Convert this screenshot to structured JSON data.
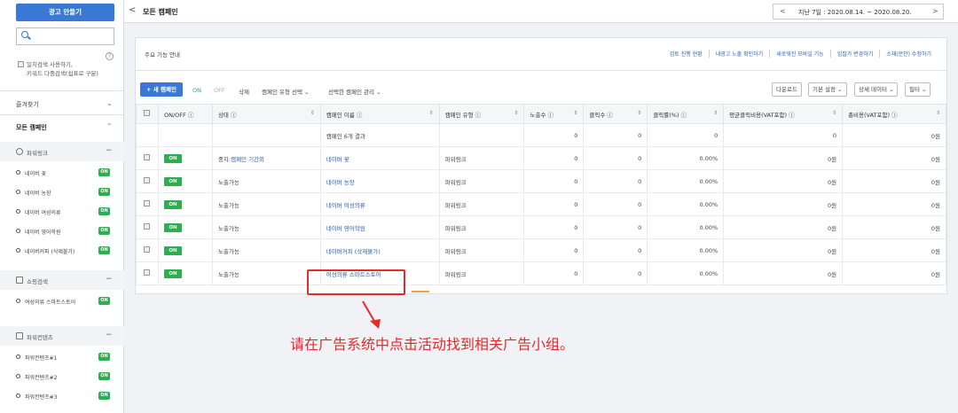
{
  "sidebar": {
    "create_ad_label": "광고 만들기",
    "search_placeholder": "",
    "option_line1": "일치검색 사용하기,",
    "option_line2": "키워드 다중검색(쉼표로 구분)",
    "help": "?",
    "favorites_label": "즐겨찾기",
    "all_campaigns_label": "모든 캠페인",
    "groups": [
      {
        "label": "파워링크",
        "items": [
          {
            "label": "네이버 꽃",
            "status": "ON"
          },
          {
            "label": "네이버 농장",
            "status": "ON"
          },
          {
            "label": "네이버 여성의류",
            "status": "ON"
          },
          {
            "label": "네이버 영어학원",
            "status": "ON"
          },
          {
            "label": "네이버커피 (삭제불가)",
            "status": "ON"
          }
        ]
      },
      {
        "label": "쇼핑검색",
        "items": [
          {
            "label": "여성의류 스마트스토어",
            "status": "ON"
          }
        ]
      },
      {
        "label": "파워컨텐츠",
        "items": [
          {
            "label": "파워컨텐츠#1",
            "status": "ON"
          },
          {
            "label": "파워컨텐츠#2",
            "status": "ON"
          },
          {
            "label": "파워컨텐츠#3",
            "status": "ON"
          }
        ]
      }
    ]
  },
  "header": {
    "back": "<",
    "title": "모든 캠페인",
    "date_prev": "<",
    "date_range": "지난 7일 : 2020.08.14. ~ 2020.08.20.",
    "date_next": ">"
  },
  "guide": {
    "label": "주요 기능 안내",
    "links": [
      "검토 진행 현황",
      "내광고 노출 확인하기",
      "새로워진 모바일 기능",
      "입찰가 변경하기",
      "소재(문안) 수정하기"
    ]
  },
  "toolbar": {
    "new_campaign": "+ 새 캠페인",
    "on": "ON",
    "off": "OFF",
    "delete": "삭제",
    "type_select": "캠페인 유형 선택 ⌄",
    "manage_select": "선택한 캠페인 관리 ⌄",
    "download": "다운로드",
    "default_setting": "기본 설정 ⌄",
    "detail_data": "상세 데이터 ⌄",
    "filter": "필터 ⌄"
  },
  "table": {
    "headers": [
      "ON/OFF ⓘ",
      "상태 ⓘ",
      "캠페인 이름 ⓘ",
      "캠페인 유형 ⓘ",
      "노출수 ⓘ",
      "클릭수 ⓘ",
      "클릭률(%) ⓘ",
      "평균클릭비용(VAT포함) ⓘ",
      "총비용(VAT포함) ⓘ"
    ],
    "total": {
      "name": "캠페인 6개 결과",
      "impressions": "0",
      "clicks": "0",
      "ctr": "0",
      "cpc": "0",
      "cost": "0원"
    },
    "rows": [
      {
        "switch": "ON",
        "status_prefix": "중지:",
        "status_link": "캠페인 기간외",
        "name": "네이버 꽃",
        "type": "파워링크",
        "impressions": "0",
        "clicks": "0",
        "ctr": "0.00%",
        "cpc": "0원",
        "cost": "0원"
      },
      {
        "switch": "ON",
        "status_prefix": "노출가능",
        "status_link": "",
        "name": "네이버 농장",
        "type": "파워링크",
        "impressions": "0",
        "clicks": "0",
        "ctr": "0.00%",
        "cpc": "0원",
        "cost": "0원"
      },
      {
        "switch": "ON",
        "status_prefix": "노출가능",
        "status_link": "",
        "name": "네이버 여성의류",
        "type": "파워링크",
        "impressions": "0",
        "clicks": "0",
        "ctr": "0.00%",
        "cpc": "0원",
        "cost": "0원"
      },
      {
        "switch": "ON",
        "status_prefix": "노출가능",
        "status_link": "",
        "name": "네이버 영어학원",
        "type": "파워링크",
        "impressions": "0",
        "clicks": "0",
        "ctr": "0.00%",
        "cpc": "0원",
        "cost": "0원"
      },
      {
        "switch": "ON",
        "status_prefix": "노출가능",
        "status_link": "",
        "name": "네이버커피 (삭제불가)",
        "type": "파워링크",
        "impressions": "0",
        "clicks": "0",
        "ctr": "0.00%",
        "cpc": "0원",
        "cost": "0원"
      },
      {
        "switch": "ON",
        "status_prefix": "노출가능",
        "status_link": "",
        "name": "여성의류 스마트스토어",
        "type": "파워링크",
        "impressions": "0",
        "clicks": "0",
        "ctr": "0.00%",
        "cpc": "0원",
        "cost": "0원"
      }
    ]
  },
  "annotation": {
    "instruction": "请在广告系统中点击活动找到相关广告小组。",
    "color": "#e42b2b"
  },
  "colors": {
    "accent": "#3a78d6",
    "on_green": "#2eaf4f",
    "link": "#2b5fb8"
  }
}
